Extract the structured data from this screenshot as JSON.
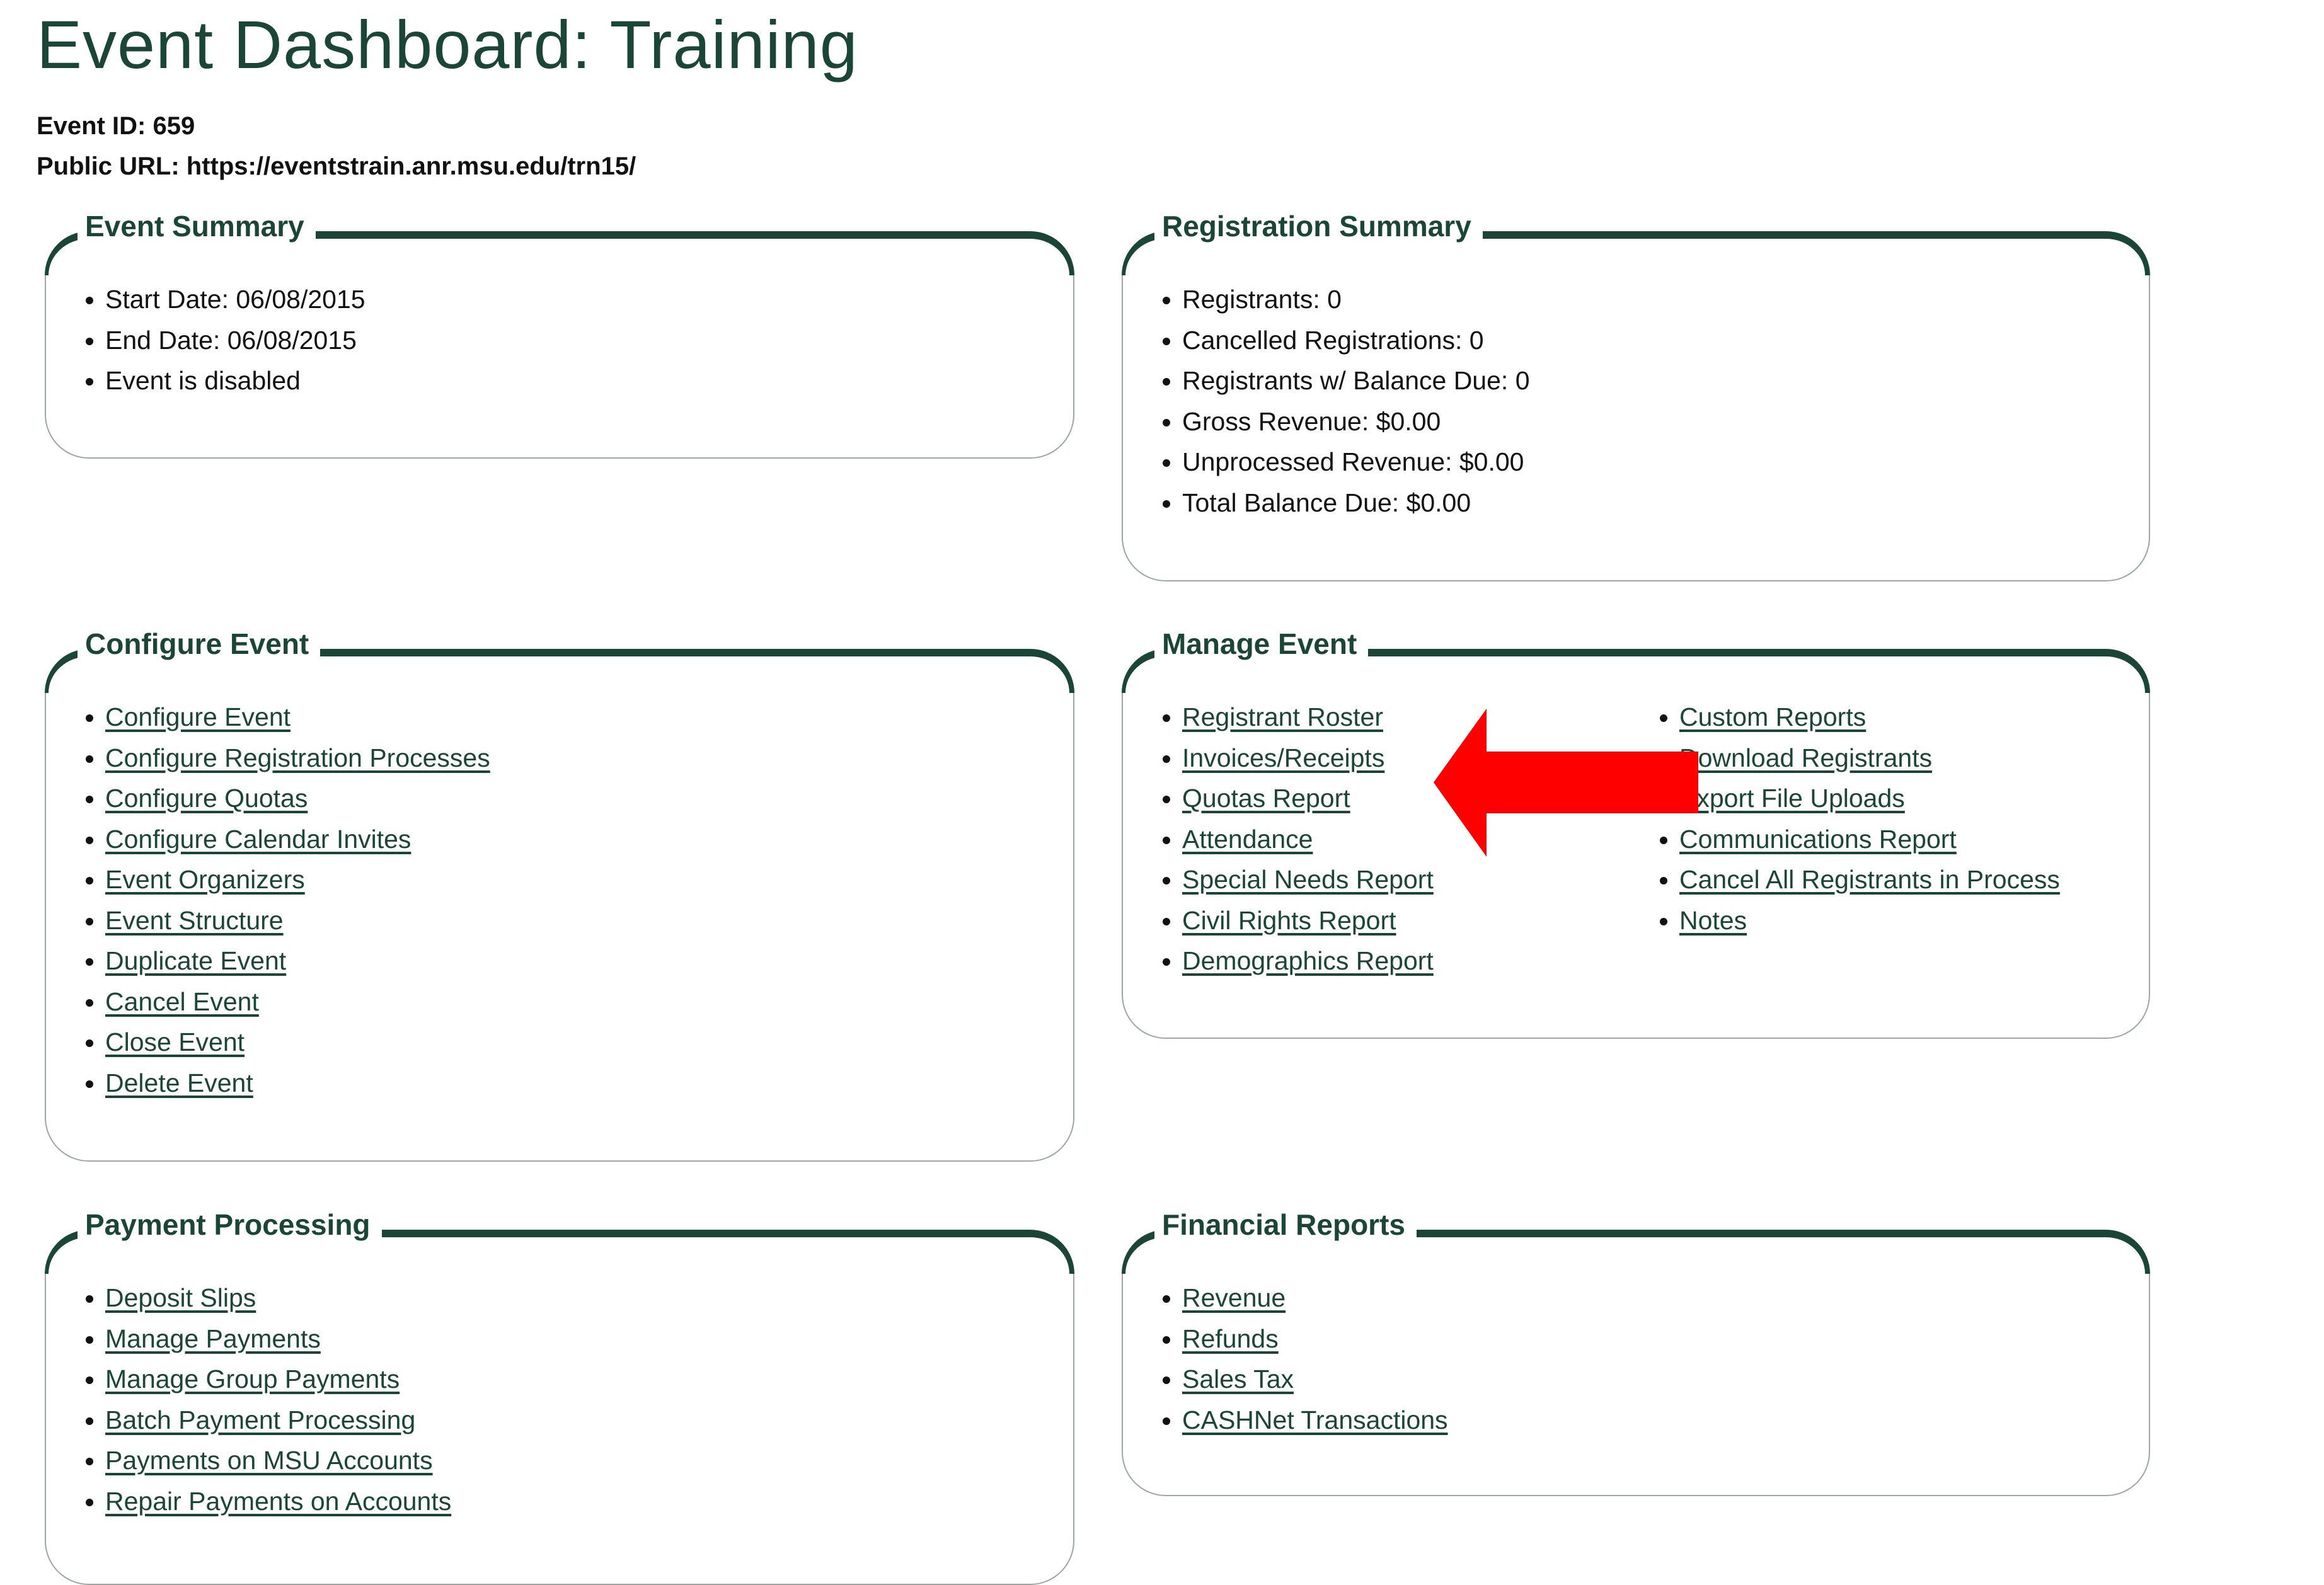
{
  "header": {
    "title": "Event Dashboard: Training",
    "event_id": "Event ID: 659",
    "public_url": "Public URL: https://eventstrain.anr.msu.edu/trn15/"
  },
  "event_summary": {
    "title": "Event Summary",
    "items": [
      "Start Date: 06/08/2015",
      "End Date: 06/08/2015",
      "Event is disabled"
    ]
  },
  "registration_summary": {
    "title": "Registration Summary",
    "items": [
      "Registrants: 0",
      "Cancelled Registrations: 0",
      "Registrants w/ Balance Due: 0",
      "Gross Revenue: $0.00",
      "Unprocessed Revenue: $0.00",
      "Total Balance Due: $0.00"
    ]
  },
  "configure_event": {
    "title": "Configure Event",
    "links": [
      "Configure Event",
      "Configure Registration Processes",
      "Configure Quotas",
      "Configure Calendar Invites",
      "Event Organizers",
      "Event Structure",
      "Duplicate Event",
      "Cancel Event",
      "Close Event",
      "Delete Event"
    ]
  },
  "manage_event": {
    "title": "Manage Event",
    "links_col1": [
      "Registrant Roster",
      "Invoices/Receipts",
      "Quotas Report",
      "Attendance",
      "Special Needs Report",
      "Civil Rights Report",
      "Demographics Report"
    ],
    "links_col2": [
      "Custom Reports",
      "Download Registrants",
      "Export File Uploads",
      "Communications Report",
      "Cancel All Registrants in Process",
      "Notes"
    ]
  },
  "payment_processing": {
    "title": "Payment Processing",
    "links": [
      "Deposit Slips",
      "Manage Payments",
      "Manage Group Payments",
      "Batch Payment Processing",
      "Payments on MSU Accounts",
      "Repair Payments on Accounts"
    ]
  },
  "financial_reports": {
    "title": "Financial Reports",
    "links": [
      "Revenue",
      "Refunds",
      "Sales Tax",
      "CASHNet Transactions"
    ]
  },
  "annotation": {
    "icon": "red-arrow-left",
    "points_to": "Invoices/Receipts",
    "color": "#ff0000"
  },
  "colors": {
    "brand": "#1b4536",
    "border": "#9aa8a3"
  }
}
